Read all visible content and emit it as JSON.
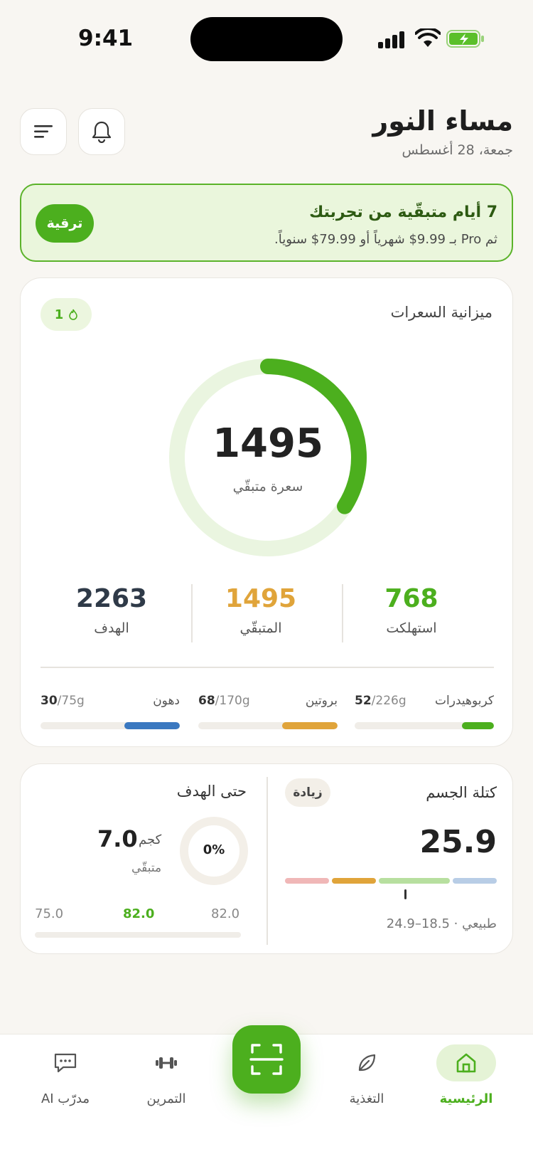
{
  "status": {
    "time": "9:41"
  },
  "header": {
    "greeting": "مساء النور",
    "date": "جمعة، 28 أغسطس"
  },
  "trial": {
    "title": "7 أيام متبقّية من تجربتك",
    "subtitle": "ثم Pro بـ 9.99$ شهرياً أو 79.99$ سنوياً.",
    "upgrade_label": "ترقية"
  },
  "calories": {
    "title": "ميزانية السعرات",
    "streak": "1",
    "remaining_value": "1495",
    "remaining_label": "سعرة متبقّي",
    "consumed_fraction": 0.34,
    "stats": [
      {
        "value": "768",
        "label": "استهلكت",
        "color": "#4caf1e"
      },
      {
        "value": "1495",
        "label": "المتبقّي",
        "color": "#e0a43a"
      },
      {
        "value": "2263",
        "label": "الهدف",
        "color": "#2f3a48"
      }
    ]
  },
  "macros": [
    {
      "name": "كربوهيدرات",
      "current": "52",
      "total": "/226g",
      "fraction": 0.23,
      "color": "#4caf1e"
    },
    {
      "name": "بروتين",
      "current": "68",
      "total": "/170g",
      "fraction": 0.4,
      "color": "#e0a43a"
    },
    {
      "name": "دهون",
      "current": "30",
      "total": "/75g",
      "fraction": 0.4,
      "color": "#3a78c0"
    }
  ],
  "bmi": {
    "title": "كتلة الجسم",
    "badge": "زيادة",
    "value": "25.9",
    "range_label": "طبيعي · 18.5–24.9",
    "segment_colors": [
      "#f0b7b7",
      "#e0a43a",
      "#b7df9f",
      "#b8cde6"
    ]
  },
  "goal": {
    "title": "حتى الهدف",
    "percent": "0%",
    "value": "7.0",
    "unit": "كجم",
    "remaining_label": "متبقّي",
    "scale_left": "75.0",
    "scale_mid": "82.0",
    "scale_right": "82.0"
  },
  "nav": {
    "home": "الرئيسية",
    "nutrition": "التغذية",
    "workout": "التمرين",
    "coach": "مدرّب AI"
  }
}
